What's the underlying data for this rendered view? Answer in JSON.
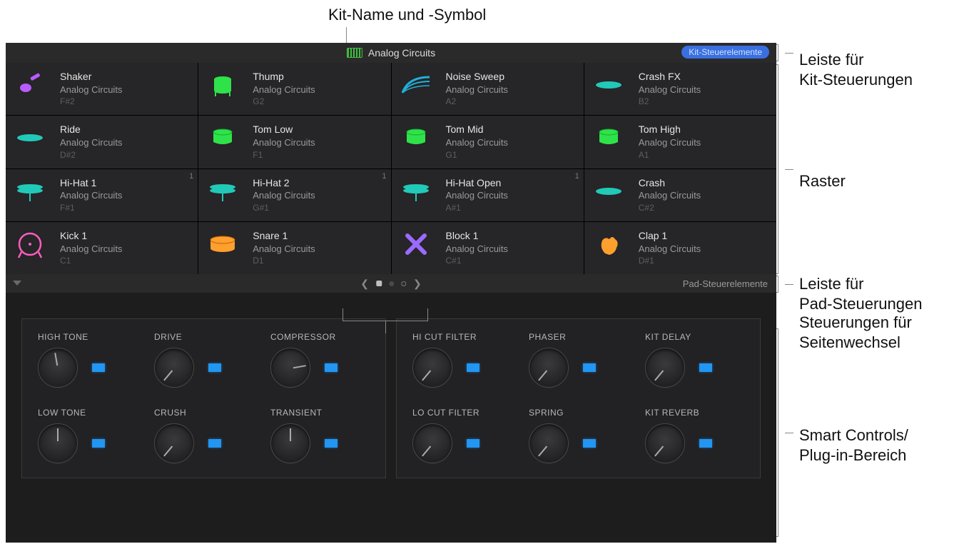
{
  "callouts": {
    "top": "Kit-Name und -Symbol",
    "right": {
      "kit_bar": "Leiste für\nKit-Steuerungen",
      "grid": "Raster",
      "pad_bar": "Leiste für\nPad-Steuerungen",
      "page": "Steuerungen für\nSeitenwechsel",
      "smart": "Smart Controls/\nPlug-in-Bereich"
    }
  },
  "kit_bar": {
    "name": "Analog Circuits",
    "button": "Kit-Steuerelemente"
  },
  "pad_bar": {
    "label": "Pad-Steuerelemente"
  },
  "pads": [
    {
      "name": "Shaker",
      "sub": "Analog Circuits",
      "note": "F#2",
      "icon": "shaker",
      "color": "#b85cff"
    },
    {
      "name": "Thump",
      "sub": "Analog Circuits",
      "note": "G2",
      "icon": "drum",
      "color": "#2fe24a"
    },
    {
      "name": "Noise Sweep",
      "sub": "Analog Circuits",
      "note": "A2",
      "icon": "sweep",
      "color": "#21b0d9"
    },
    {
      "name": "Crash FX",
      "sub": "Analog Circuits",
      "note": "B2",
      "icon": "cymbal-flat",
      "color": "#21c9b8"
    },
    {
      "name": "Ride",
      "sub": "Analog Circuits",
      "note": "D#2",
      "icon": "cymbal-flat",
      "color": "#21c9b8"
    },
    {
      "name": "Tom Low",
      "sub": "Analog Circuits",
      "note": "F1",
      "icon": "tom",
      "color": "#2fe24a"
    },
    {
      "name": "Tom Mid",
      "sub": "Analog Circuits",
      "note": "G1",
      "icon": "tom",
      "color": "#2fe24a"
    },
    {
      "name": "Tom High",
      "sub": "Analog Circuits",
      "note": "A1",
      "icon": "tom",
      "color": "#2fe24a"
    },
    {
      "name": "Hi-Hat 1",
      "sub": "Analog Circuits",
      "note": "F#1",
      "icon": "hihat",
      "color": "#21c9b8",
      "badge": "1"
    },
    {
      "name": "Hi-Hat 2",
      "sub": "Analog Circuits",
      "note": "G#1",
      "icon": "hihat",
      "color": "#21c9b8",
      "badge": "1"
    },
    {
      "name": "Hi-Hat Open",
      "sub": "Analog Circuits",
      "note": "A#1",
      "icon": "hihat",
      "color": "#21c9b8",
      "badge": "1"
    },
    {
      "name": "Crash",
      "sub": "Analog Circuits",
      "note": "C#2",
      "icon": "cymbal-flat",
      "color": "#21c9b8"
    },
    {
      "name": "Kick 1",
      "sub": "Analog Circuits",
      "note": "C1",
      "icon": "kick",
      "color": "#ff5cc0"
    },
    {
      "name": "Snare 1",
      "sub": "Analog Circuits",
      "note": "D1",
      "icon": "snare",
      "color": "#ff9f2e"
    },
    {
      "name": "Block 1",
      "sub": "Analog Circuits",
      "note": "C#1",
      "icon": "sticks",
      "color": "#9b6bff"
    },
    {
      "name": "Clap 1",
      "sub": "Analog Circuits",
      "note": "D#1",
      "icon": "clap",
      "color": "#ff9f2e"
    }
  ],
  "knobs": {
    "left": [
      {
        "label": "HIGH TONE",
        "angle": -10
      },
      {
        "label": "DRIVE",
        "angle": -140
      },
      {
        "label": "COMPRESSOR",
        "angle": 80
      },
      {
        "label": "LOW TONE",
        "angle": 0
      },
      {
        "label": "CRUSH",
        "angle": -140
      },
      {
        "label": "TRANSIENT",
        "angle": 0
      }
    ],
    "right": [
      {
        "label": "HI CUT FILTER",
        "angle": -140
      },
      {
        "label": "PHASER",
        "angle": -140
      },
      {
        "label": "KIT DELAY",
        "angle": -140
      },
      {
        "label": "LO CUT FILTER",
        "angle": -140
      },
      {
        "label": "SPRING",
        "angle": -140
      },
      {
        "label": "KIT REVERB",
        "angle": -140
      }
    ]
  }
}
